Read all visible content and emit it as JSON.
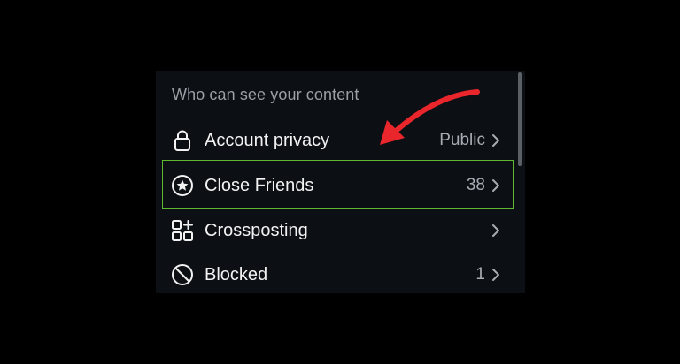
{
  "section": {
    "header": "Who can see your content"
  },
  "rows": [
    {
      "label": "Account privacy",
      "value": "Public",
      "icon": "lock-icon"
    },
    {
      "label": "Close Friends",
      "value": "38",
      "icon": "star-circle-icon"
    },
    {
      "label": "Crossposting",
      "value": "",
      "icon": "grid-add-icon"
    },
    {
      "label": "Blocked",
      "value": "1",
      "icon": "blocked-icon"
    }
  ],
  "colors": {
    "background": "#000000",
    "panel": "#0c0f14",
    "text": "#f2f2f2",
    "muted": "#a8adb3",
    "highlight_border": "#5fb832",
    "annotation_arrow": "#e8262b"
  }
}
